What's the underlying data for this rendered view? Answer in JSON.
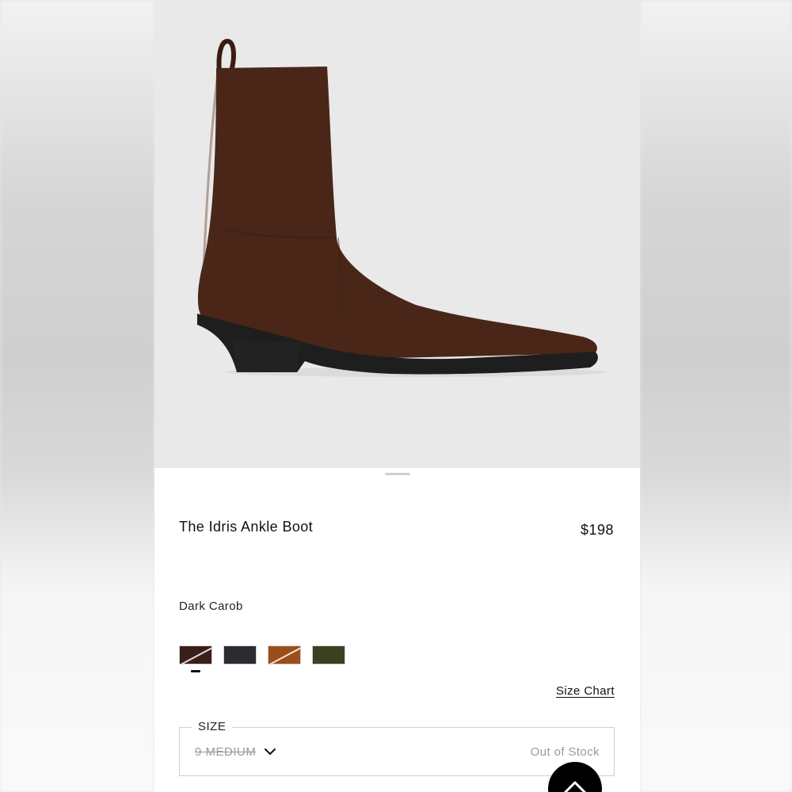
{
  "product": {
    "name": "The Idris Ankle Boot",
    "price": "$198",
    "color_name": "Dark Carob",
    "image_alt": "boot-product-image"
  },
  "swatches": [
    {
      "name": "dark-carob",
      "color": "#3b1f17",
      "selected": true
    },
    {
      "name": "black",
      "color": "#2a2c30",
      "selected": false
    },
    {
      "name": "tan",
      "color": "#9c4d1a",
      "selected": false
    },
    {
      "name": "olive",
      "color": "#3c4020",
      "selected": false
    }
  ],
  "links": {
    "size_chart": "Size Chart"
  },
  "size_selector": {
    "label": "SIZE",
    "selected_value": "9 MEDIUM",
    "status": "Out of Stock"
  },
  "icons": {
    "dropdown": "chevron-down-icon",
    "back_to_top": "chevron-up-icon"
  },
  "colors": {
    "hero_bg": "#e9e9e9",
    "boot_suede": "#4a2618",
    "sole": "#1e1e1e",
    "page_bg": "#ffffff"
  }
}
